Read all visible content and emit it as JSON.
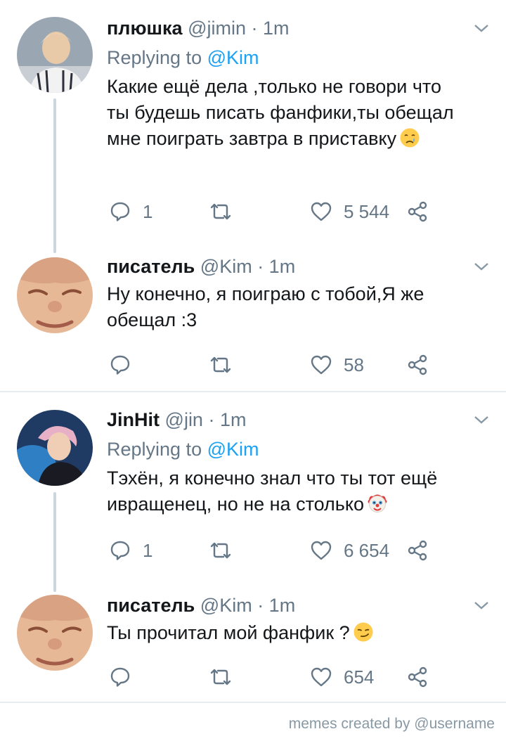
{
  "tweets": [
    {
      "display_name": "плюшка",
      "meta": "@jimin · 1m",
      "replying_prefix": "Replying to ",
      "replying_mention": "@Kim",
      "text": "Какие ещё дела ,только не говори что ты будешь писать  фанфики,ты обещал мне поиграть завтра в приставку",
      "emoji": "crying-face",
      "reply_count": "1",
      "retweet_count": "",
      "like_count": "5 544"
    },
    {
      "display_name": "писатель",
      "meta": "@Kim · 1m",
      "text": "Ну конечно, я поиграю с тобой,Я же обещал :3",
      "reply_count": "",
      "retweet_count": "",
      "like_count": "58"
    },
    {
      "display_name": "JinHit",
      "meta": "@jin · 1m",
      "replying_prefix": "Replying to ",
      "replying_mention": "@Kim",
      "text": "Тэхён, я конечно знал что ты тот ещё ивращенец, но не на столько",
      "emoji": "clown-face",
      "reply_count": "1",
      "retweet_count": "",
      "like_count": "6 654"
    },
    {
      "display_name": "писатель",
      "meta": "@Kim · 1m",
      "text": "Ты прочитал мой фанфик ?",
      "emoji": "smirking-face",
      "reply_count": "",
      "retweet_count": "",
      "like_count": "654"
    }
  ],
  "footer": "memes created by @username",
  "colors": {
    "accent": "#1da1f2",
    "muted": "#657786",
    "thread_line": "#ccd6dd",
    "divider": "#e6ecf0"
  }
}
